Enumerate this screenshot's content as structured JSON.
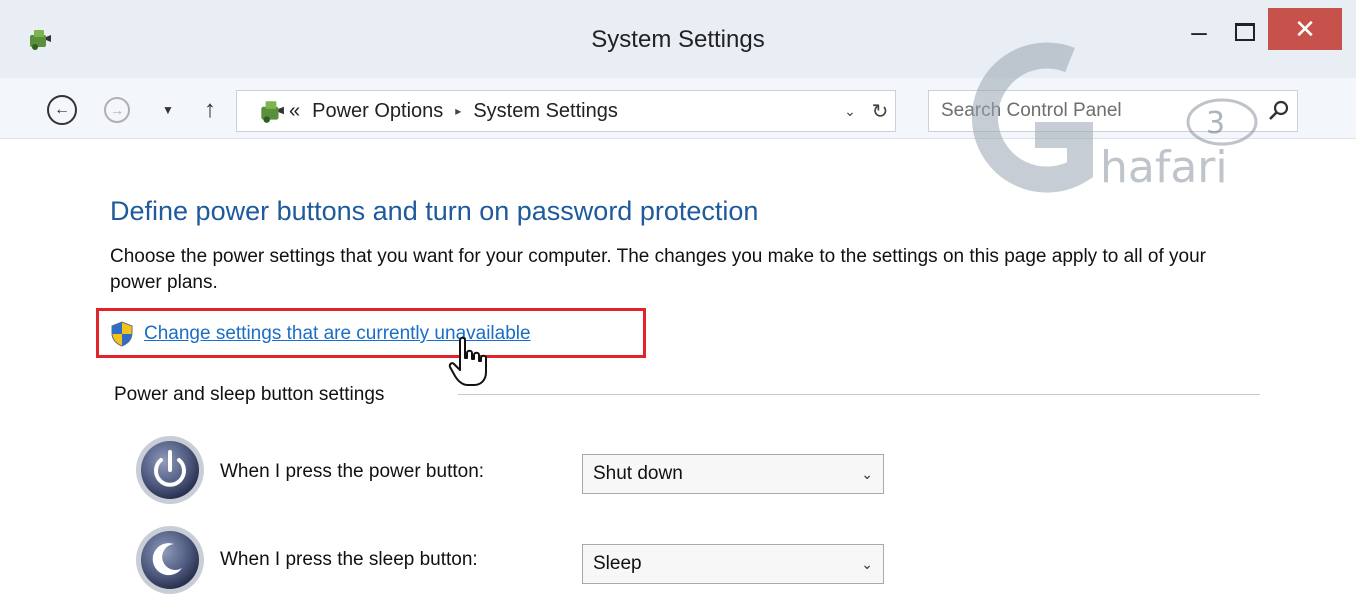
{
  "window": {
    "title": "System Settings",
    "minimize_label": "–",
    "close_label": "✕"
  },
  "nav": {
    "back_glyph": "←",
    "forward_glyph": "→",
    "recent_glyph": "▼",
    "up_glyph": "↑"
  },
  "address": {
    "prefix": "«",
    "crumbs": [
      "Power Options",
      "System Settings"
    ],
    "separator": "▸",
    "dropdown_glyph": "⌄",
    "refresh_glyph": "↻"
  },
  "search": {
    "placeholder": "Search Control Panel"
  },
  "watermark": {
    "text": "Ghafari"
  },
  "main": {
    "heading": "Define power buttons and turn on password protection",
    "description": "Choose the power settings that you want for your computer. The changes you make to the settings on this page apply to all of your power plans.",
    "link_text": "Change settings that are currently unavailable",
    "group_label": "Power and sleep button settings",
    "settings": [
      {
        "label": "When I press the power button:",
        "value": "Shut down"
      },
      {
        "label": "When I press the sleep button:",
        "value": "Sleep"
      }
    ],
    "select_arrow": "⌄"
  },
  "colors": {
    "heading": "#1e5a9c",
    "link": "#1a6ec7",
    "highlight": "#e0242a",
    "close_button": "#c7514b"
  },
  "icons": {
    "app": "power-options-icon",
    "shield": "uac-shield-icon",
    "cursor": "hand-pointer-icon",
    "power": "power-button-icon",
    "sleep": "sleep-button-icon",
    "search": "magnifier-icon"
  }
}
